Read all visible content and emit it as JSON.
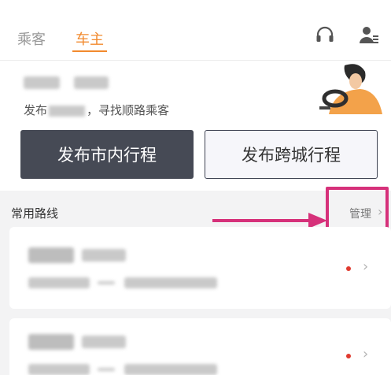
{
  "tabs": [
    {
      "label": "乘客",
      "active": false
    },
    {
      "label": "车主",
      "active": true
    }
  ],
  "icons": {
    "headset": "headset-icon",
    "profile": "profile-icon"
  },
  "hero": {
    "subtitle_prefix": "发布",
    "subtitle_suffix": "，寻找顺路乘客"
  },
  "buttons": {
    "city_trip": "发布市内行程",
    "intercity_trip": "发布跨城行程"
  },
  "routes": {
    "title": "常用路线",
    "manage_label": "管理",
    "chevron": "›",
    "items": [
      {
        "has_dot": true,
        "chevron": "›"
      },
      {
        "has_dot": true,
        "chevron": "›"
      }
    ]
  },
  "colors": {
    "accent": "#f28a2e",
    "dark_button": "#464a55",
    "annotation": "#d6317a",
    "dot": "#e03a2f"
  }
}
